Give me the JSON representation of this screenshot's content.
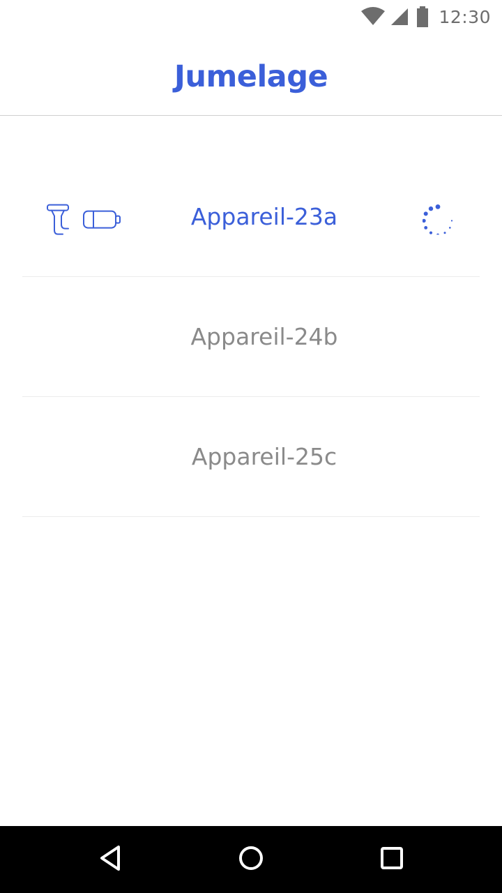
{
  "status_bar": {
    "time": "12:30",
    "icons": [
      "wifi-icon",
      "cell-signal-icon",
      "battery-icon"
    ]
  },
  "header": {
    "title": "Jumelage"
  },
  "devices": [
    {
      "name": "Appareil-23a",
      "active": true,
      "icons": [
        "handpiece-icon",
        "battery-outline-icon"
      ],
      "status": "connecting-spinner-icon"
    },
    {
      "name": "Appareil-24b",
      "active": false
    },
    {
      "name": "Appareil-25c",
      "active": false
    }
  ],
  "navigation": {
    "buttons": [
      "back-icon",
      "home-icon",
      "recents-icon"
    ]
  },
  "colors": {
    "accent": "#3b5fd9",
    "inactive_text": "#8a8a8a",
    "divider": "#ececec",
    "nav_bar": "#000000",
    "status_icons": "#6d6d6d"
  }
}
